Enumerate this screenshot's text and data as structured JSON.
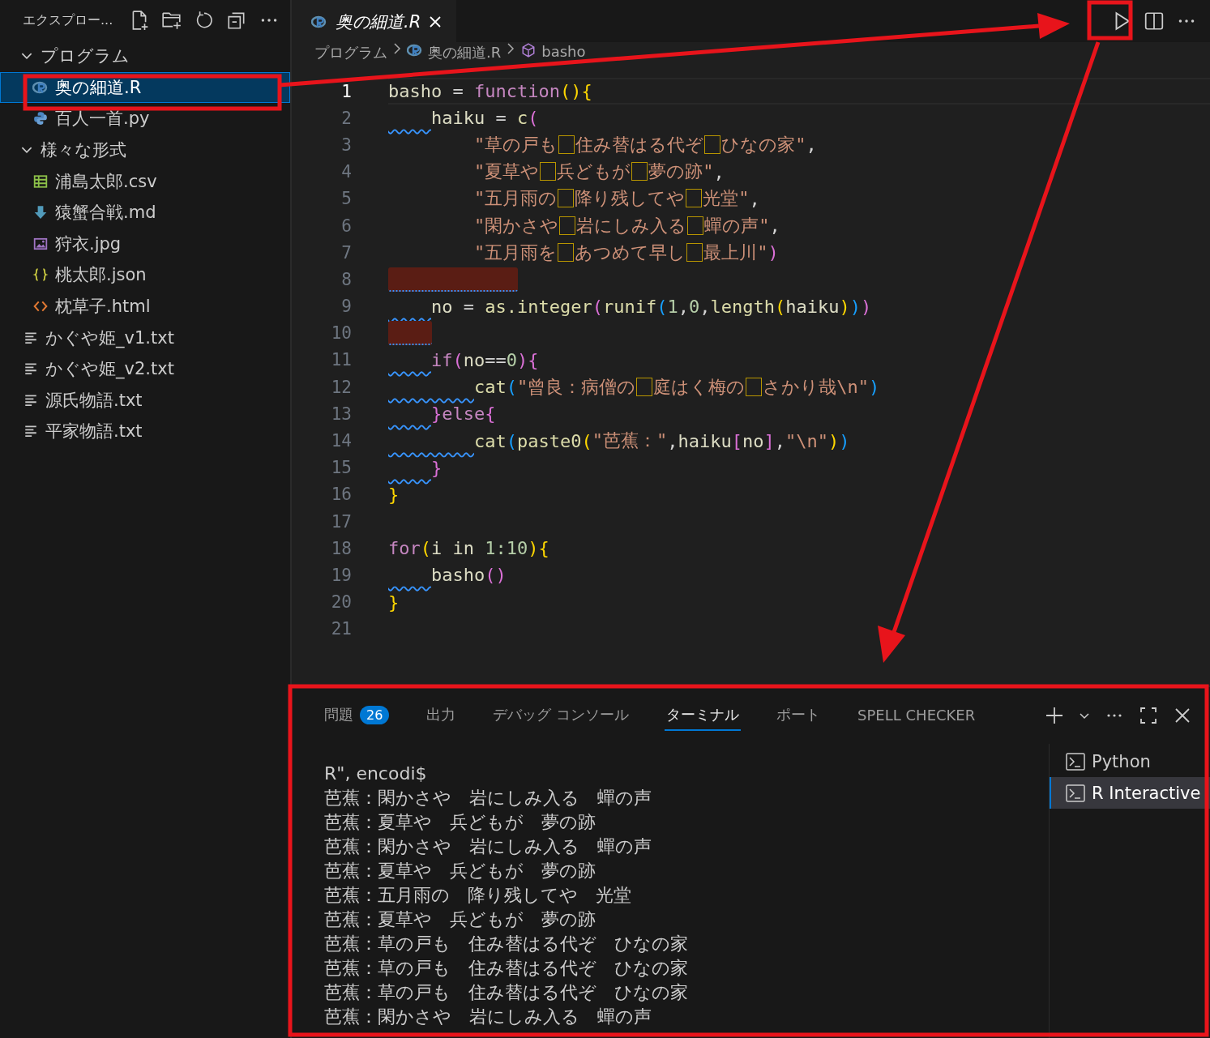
{
  "sidebar": {
    "title": "エクスプロー...",
    "tree": [
      {
        "kind": "folder",
        "name": "プログラム",
        "expanded": true,
        "children": [
          {
            "kind": "r",
            "name": "奥の細道.R",
            "selected": true
          },
          {
            "kind": "python",
            "name": "百人一首.py",
            "selected": false
          }
        ]
      },
      {
        "kind": "folder",
        "name": "様々な形式",
        "expanded": true,
        "children": [
          {
            "kind": "csv",
            "name": "浦島太郎.csv",
            "selected": false
          },
          {
            "kind": "markdown",
            "name": "猿蟹合戦.md",
            "selected": false
          },
          {
            "kind": "image",
            "name": "狩衣.jpg",
            "selected": false
          },
          {
            "kind": "json",
            "name": "桃太郎.json",
            "selected": false
          },
          {
            "kind": "html",
            "name": "枕草子.html",
            "selected": false
          }
        ]
      },
      {
        "kind": "text",
        "name": "かぐや姫_v1.txt",
        "selected": false
      },
      {
        "kind": "text",
        "name": "かぐや姫_v2.txt",
        "selected": false
      },
      {
        "kind": "text",
        "name": "源氏物語.txt",
        "selected": false
      },
      {
        "kind": "text",
        "name": "平家物語.txt",
        "selected": false
      }
    ]
  },
  "editor": {
    "tab": {
      "title": "奥の細道.R"
    },
    "breadcrumb": [
      "プログラム",
      "奥の細道.R",
      "basho"
    ],
    "lines": [
      {
        "number": "1",
        "kind": "code",
        "current": true,
        "tokens": [
          {
            "kind": "ident",
            "text": "basho"
          },
          {
            "kind": "op",
            "text": " = "
          },
          {
            "kind": "kw",
            "text": "function"
          },
          {
            "kind": "b1",
            "text": "()"
          },
          {
            "kind": "b1",
            "text": "{"
          }
        ]
      },
      {
        "number": "2",
        "kind": "code",
        "current": false,
        "lint": true,
        "tokens": [
          {
            "kind": "ident",
            "text": "    haiku"
          },
          {
            "kind": "op",
            "text": " = "
          },
          {
            "kind": "func",
            "text": "c"
          },
          {
            "kind": "b2",
            "text": "("
          }
        ]
      },
      {
        "number": "3",
        "kind": "code",
        "current": false,
        "lint": false,
        "tokens": [
          {
            "kind": "str",
            "text": "        \"草の戸も　住み替はる代ぞ　ひなの家\""
          },
          {
            "kind": "op",
            "text": ","
          }
        ]
      },
      {
        "number": "4",
        "kind": "code",
        "current": false,
        "lint": false,
        "tokens": [
          {
            "kind": "str",
            "text": "        \"夏草や　兵どもが　夢の跡\""
          },
          {
            "kind": "op",
            "text": ","
          }
        ]
      },
      {
        "number": "5",
        "kind": "code",
        "current": false,
        "lint": false,
        "tokens": [
          {
            "kind": "str",
            "text": "        \"五月雨の　降り残してや　光堂\""
          },
          {
            "kind": "op",
            "text": ","
          }
        ]
      },
      {
        "number": "6",
        "kind": "code",
        "current": false,
        "lint": false,
        "tokens": [
          {
            "kind": "str",
            "text": "        \"閑かさや　岩にしみ入る　蟬の声\""
          },
          {
            "kind": "op",
            "text": ","
          }
        ]
      },
      {
        "number": "7",
        "kind": "code",
        "current": false,
        "lint": false,
        "tokens": [
          {
            "kind": "str",
            "text": "        \"五月雨を　あつめて早し　最上川\""
          },
          {
            "kind": "b2",
            "text": ")"
          }
        ]
      },
      {
        "number": "8",
        "kind": "whitespace_error_long",
        "current": false
      },
      {
        "number": "9",
        "kind": "code",
        "current": false,
        "lint": true,
        "tokens": [
          {
            "kind": "ident",
            "text": "    no"
          },
          {
            "kind": "op",
            "text": " = "
          },
          {
            "kind": "func",
            "text": "as.integer"
          },
          {
            "kind": "b2",
            "text": "("
          },
          {
            "kind": "func",
            "text": "runif"
          },
          {
            "kind": "b3",
            "text": "("
          },
          {
            "kind": "num",
            "text": "1"
          },
          {
            "kind": "op",
            "text": ","
          },
          {
            "kind": "num",
            "text": "0"
          },
          {
            "kind": "op",
            "text": ","
          },
          {
            "kind": "func",
            "text": "length"
          },
          {
            "kind": "b1",
            "text": "("
          },
          {
            "kind": "ident",
            "text": "haiku"
          },
          {
            "kind": "b1",
            "text": ")"
          },
          {
            "kind": "b3",
            "text": ")"
          },
          {
            "kind": "b2",
            "text": ")"
          }
        ]
      },
      {
        "number": "10",
        "kind": "whitespace_error_short",
        "current": false
      },
      {
        "number": "11",
        "kind": "code",
        "current": false,
        "lint": true,
        "tokens": [
          {
            "kind": "kw",
            "text": "    if"
          },
          {
            "kind": "b2",
            "text": "("
          },
          {
            "kind": "ident",
            "text": "no"
          },
          {
            "kind": "op",
            "text": "=="
          },
          {
            "kind": "num",
            "text": "0"
          },
          {
            "kind": "b2",
            "text": ")"
          },
          {
            "kind": "b2",
            "text": "{"
          }
        ]
      },
      {
        "number": "12",
        "kind": "code",
        "current": false,
        "lint": true,
        "tokens": [
          {
            "kind": "func",
            "text": "        cat"
          },
          {
            "kind": "b3",
            "text": "("
          },
          {
            "kind": "str",
            "text": "\"曾良：病僧の　庭はく梅の　さかり哉\\n\""
          },
          {
            "kind": "b3",
            "text": ")"
          }
        ]
      },
      {
        "number": "13",
        "kind": "code",
        "current": false,
        "lint": true,
        "tokens": [
          {
            "kind": "b2",
            "text": "    }"
          },
          {
            "kind": "kw",
            "text": "else"
          },
          {
            "kind": "b2",
            "text": "{"
          }
        ]
      },
      {
        "number": "14",
        "kind": "code",
        "current": false,
        "lint": true,
        "tokens": [
          {
            "kind": "func",
            "text": "        cat"
          },
          {
            "kind": "b3",
            "text": "("
          },
          {
            "kind": "func",
            "text": "paste0"
          },
          {
            "kind": "b1",
            "text": "("
          },
          {
            "kind": "str",
            "text": "\"芭蕉：\""
          },
          {
            "kind": "op",
            "text": ","
          },
          {
            "kind": "ident",
            "text": "haiku"
          },
          {
            "kind": "b2",
            "text": "["
          },
          {
            "kind": "ident",
            "text": "no"
          },
          {
            "kind": "b2",
            "text": "]"
          },
          {
            "kind": "op",
            "text": ","
          },
          {
            "kind": "str",
            "text": "\"\\n\""
          },
          {
            "kind": "b1",
            "text": ")"
          },
          {
            "kind": "b3",
            "text": ")"
          }
        ]
      },
      {
        "number": "15",
        "kind": "code",
        "current": false,
        "lint": true,
        "tokens": [
          {
            "kind": "b2",
            "text": "    }"
          }
        ]
      },
      {
        "number": "16",
        "kind": "code",
        "current": false,
        "tokens": [
          {
            "kind": "b1",
            "text": "}"
          }
        ]
      },
      {
        "number": "17",
        "kind": "code",
        "current": false
      },
      {
        "number": "18",
        "kind": "code",
        "current": false,
        "tokens": [
          {
            "kind": "kw",
            "text": "for"
          },
          {
            "kind": "b1",
            "text": "("
          },
          {
            "kind": "ident",
            "text": "i in "
          },
          {
            "kind": "num",
            "text": "1:10"
          },
          {
            "kind": "b1",
            "text": ")"
          },
          {
            "kind": "b1",
            "text": "{"
          }
        ]
      },
      {
        "number": "19",
        "kind": "code",
        "current": false,
        "lint": true,
        "tokens": [
          {
            "kind": "ident",
            "text": "    basho"
          },
          {
            "kind": "b2",
            "text": "()"
          }
        ]
      },
      {
        "number": "20",
        "kind": "code",
        "current": false,
        "tokens": [
          {
            "kind": "b1",
            "text": "}"
          }
        ]
      },
      {
        "number": "21",
        "kind": "code",
        "current": false
      }
    ]
  },
  "panel": {
    "tabs": [
      {
        "label": "問題",
        "badge": "26",
        "selected": false
      },
      {
        "label": "出力",
        "selected": false
      },
      {
        "label": "デバッグ コンソール",
        "selected": false
      },
      {
        "label": "ターミナル",
        "selected": true
      },
      {
        "label": "ポート",
        "selected": false
      },
      {
        "label": "SPELL CHECKER",
        "selected": false
      }
    ],
    "terminal_lines": [
      "R\", encodi$",
      "芭蕉：閑かさや　岩にしみ入る　蟬の声",
      "芭蕉：夏草や　兵どもが　夢の跡",
      "芭蕉：閑かさや　岩にしみ入る　蟬の声",
      "芭蕉：夏草や　兵どもが　夢の跡",
      "芭蕉：五月雨の　降り残してや　光堂",
      "芭蕉：夏草や　兵どもが　夢の跡",
      "芭蕉：草の戸も　住み替はる代ぞ　ひなの家",
      "芭蕉：草の戸も　住み替はる代ぞ　ひなの家",
      "芭蕉：草の戸も　住み替はる代ぞ　ひなの家",
      "芭蕉：閑かさや　岩にしみ入る　蟬の声"
    ],
    "terminals": [
      {
        "name": "Python",
        "selected": false
      },
      {
        "name": "R Interactive",
        "selected": true
      }
    ]
  }
}
